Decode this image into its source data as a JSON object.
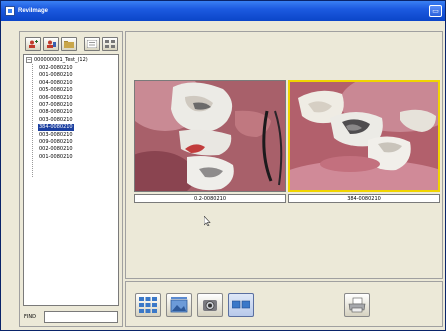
{
  "window": {
    "title": "ReviImage",
    "title_button_glyph": "▭"
  },
  "toolbar": {
    "buttons": [
      {
        "icon": "add-patient-icon"
      },
      {
        "icon": "patient-info-icon"
      },
      {
        "icon": "folder-icon"
      },
      {
        "icon": "list-view-icon"
      },
      {
        "icon": "grid-view-icon"
      }
    ]
  },
  "tree": {
    "expander": "−",
    "root_label": "000000001_Test_(12)",
    "items": [
      {
        "label": "002-0080210",
        "selected": false
      },
      {
        "label": "001-0080210",
        "selected": false
      },
      {
        "label": "004-0080210",
        "selected": false
      },
      {
        "label": "005-0080210",
        "selected": false
      },
      {
        "label": "006-0080210",
        "selected": false
      },
      {
        "label": "007-0080210",
        "selected": false
      },
      {
        "label": "008-0080210",
        "selected": false
      },
      {
        "label": "003-0080210",
        "selected": false
      },
      {
        "label": "384-0080210",
        "selected": true
      },
      {
        "label": "003-0080210",
        "selected": false
      },
      {
        "label": "009-0080210",
        "selected": false
      },
      {
        "label": "002-0080210",
        "selected": false
      },
      {
        "label": "001-0080210",
        "selected": false
      }
    ]
  },
  "find": {
    "label": "FIND",
    "value": ""
  },
  "viewer": {
    "images": [
      {
        "caption": "0.2-0080210",
        "selected": false
      },
      {
        "caption": "384-0080210",
        "selected": true
      }
    ]
  },
  "bottom_toolbar": {
    "buttons": [
      {
        "icon": "multi-grid-icon",
        "active": false
      },
      {
        "icon": "single-image-icon",
        "active": false
      },
      {
        "icon": "camera-capture-icon",
        "active": false
      },
      {
        "icon": "dual-view-icon",
        "active": true
      },
      {
        "icon": "print-icon",
        "active": false
      }
    ]
  },
  "colors": {
    "title_bar": "#0b45c8",
    "selection": "#1b3fa0",
    "selected_frame": "#f0d400",
    "background": "#ece9d8"
  }
}
